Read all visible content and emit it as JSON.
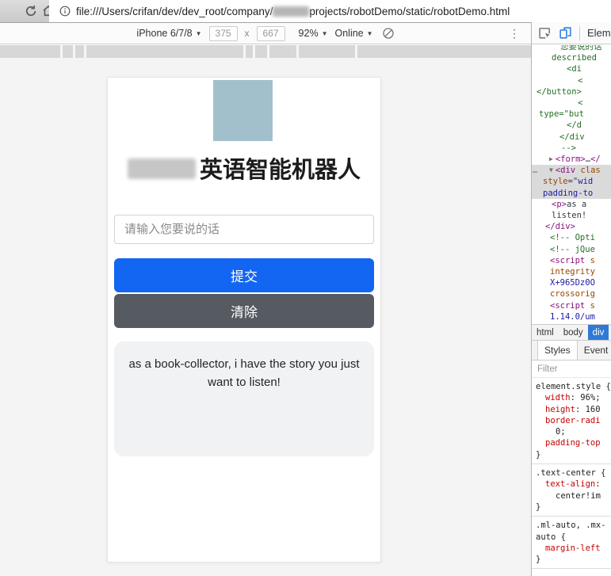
{
  "browser": {
    "url_prefix": "file:///Users/crifan/dev/dev_root/company/",
    "url_suffix": "projects/robotDemo/static/robotDemo.html"
  },
  "device_toolbar": {
    "device": "iPhone 6/7/8",
    "width": "375",
    "x_separator": "x",
    "height": "667",
    "zoom": "92%",
    "network": "Online"
  },
  "page": {
    "title": "英语智能机器人",
    "input_placeholder": "请输入您要说的话",
    "submit_label": "提交",
    "clear_label": "清除",
    "result_text": "as a book-collector, i have the story you just want to listen!"
  },
  "devtools": {
    "panel_tab": "Elements",
    "code_lines": [
      {
        "ind": 30,
        "segs": [
          [
            "您要说的话",
            "comment"
          ]
        ]
      },
      {
        "ind": 19,
        "segs": [
          [
            "described",
            "comment"
          ]
        ]
      },
      {
        "ind": 38,
        "segs": [
          [
            "<di",
            "comment"
          ]
        ]
      },
      {
        "ind": 52,
        "segs": [
          [
            "<",
            "comment"
          ]
        ]
      },
      {
        "ind": 0,
        "segs": [
          [
            "</button>",
            "comment"
          ]
        ]
      },
      {
        "ind": 52,
        "segs": [
          [
            "<",
            "comment"
          ]
        ]
      },
      {
        "ind": 3,
        "segs": [
          [
            "type=\"but",
            "comment"
          ]
        ]
      },
      {
        "ind": 38,
        "segs": [
          [
            "</d",
            "comment"
          ]
        ]
      },
      {
        "ind": 29,
        "segs": [
          [
            "</div",
            "comment"
          ]
        ]
      },
      {
        "ind": 31,
        "segs": [
          [
            "-->",
            "comment"
          ]
        ]
      },
      {
        "ind": 16,
        "arrow": "▶",
        "segs": [
          [
            "<form>",
            "tag"
          ],
          [
            "…",
            "text"
          ],
          [
            "</",
            "tag"
          ]
        ]
      },
      {
        "ind": 16,
        "arrow": "▼",
        "sel": true,
        "gutter": "…",
        "segs": [
          [
            "<div",
            "tag"
          ],
          [
            " clas",
            "attr"
          ]
        ]
      },
      {
        "ind": 8,
        "sel": true,
        "segs": [
          [
            "style",
            "attr"
          ],
          [
            "=\"",
            "text"
          ],
          [
            "wid",
            "val"
          ]
        ]
      },
      {
        "ind": 8,
        "sel": true,
        "segs": [
          [
            "padding-to",
            "val"
          ]
        ]
      },
      {
        "ind": 19,
        "segs": [
          [
            "<p>",
            "tag"
          ],
          [
            "as a",
            "text"
          ]
        ]
      },
      {
        "ind": 19,
        "segs": [
          [
            "listen!",
            "text"
          ]
        ]
      },
      {
        "ind": 11,
        "segs": [
          [
            "</div>",
            "tag"
          ]
        ]
      },
      {
        "ind": 17,
        "segs": [
          [
            "<!-- Opti",
            "comment"
          ]
        ]
      },
      {
        "ind": 17,
        "segs": [
          [
            "<!-- jQue",
            "comment"
          ]
        ]
      },
      {
        "ind": 17,
        "segs": [
          [
            "<script",
            "tag"
          ],
          [
            " s",
            "attr"
          ]
        ]
      },
      {
        "ind": 17,
        "segs": [
          [
            "integrity",
            "attr"
          ]
        ]
      },
      {
        "ind": 17,
        "segs": [
          [
            "X+965Dz0O",
            "val"
          ]
        ]
      },
      {
        "ind": 17,
        "segs": [
          [
            "crossorig",
            "attr"
          ]
        ]
      },
      {
        "ind": 17,
        "segs": [
          [
            "<script",
            "tag"
          ],
          [
            " s",
            "attr"
          ]
        ]
      },
      {
        "ind": 17,
        "segs": [
          [
            "1.14.0/um",
            "val"
          ]
        ]
      }
    ],
    "breadcrumbs": [
      {
        "label": "html",
        "active": false
      },
      {
        "label": "body",
        "active": false
      },
      {
        "label": "div",
        "active": true
      }
    ],
    "sidebar_tabs": [
      {
        "label": "Styles",
        "active": true
      },
      {
        "label": "Event Listeners",
        "active": false
      }
    ],
    "filter_label": "Filter",
    "style_rules": [
      {
        "lines": [
          {
            "ind": 1,
            "segs": [
              [
                "element.style",
                "sel"
              ],
              [
                " {",
                "plain"
              ]
            ]
          },
          {
            "ind": 13,
            "segs": [
              [
                "width",
                "prop"
              ],
              [
                ": ",
                "plain"
              ],
              [
                "96%;",
                "val2"
              ]
            ]
          },
          {
            "ind": 13,
            "segs": [
              [
                "height",
                "prop"
              ],
              [
                ": ",
                "plain"
              ],
              [
                "160",
                "val2"
              ]
            ]
          },
          {
            "ind": 13,
            "segs": [
              [
                "border-radi",
                "prop"
              ]
            ]
          },
          {
            "ind": 26,
            "segs": [
              [
                "0;",
                "val2"
              ]
            ]
          },
          {
            "ind": 13,
            "segs": [
              [
                "padding-top",
                "prop"
              ]
            ]
          },
          {
            "ind": 1,
            "segs": [
              [
                "}",
                "plain"
              ]
            ]
          }
        ]
      },
      {
        "lines": [
          {
            "ind": 1,
            "segs": [
              [
                ".text-center {",
                "sel"
              ]
            ]
          },
          {
            "ind": 13,
            "segs": [
              [
                "text-align",
                "prop"
              ],
              [
                ":",
                "plain"
              ]
            ]
          },
          {
            "ind": 26,
            "segs": [
              [
                "center!im",
                "val2"
              ]
            ]
          },
          {
            "ind": 1,
            "segs": [
              [
                "}",
                "plain"
              ]
            ]
          }
        ]
      },
      {
        "lines": [
          {
            "ind": 1,
            "segs": [
              [
                ".ml-auto, .mx-",
                "sel"
              ]
            ]
          },
          {
            "ind": 1,
            "segs": [
              [
                "auto {",
                "sel"
              ]
            ]
          },
          {
            "ind": 13,
            "segs": [
              [
                "margin-left",
                "prop"
              ]
            ]
          },
          {
            "ind": 1,
            "segs": [
              [
                "}",
                "plain"
              ]
            ]
          }
        ]
      }
    ]
  },
  "colors": {
    "primary_button": "#1266f1",
    "secondary_button": "#565b62",
    "logo_placeholder": "#a2bfcc",
    "crumb_active": "#2e7ad7"
  }
}
